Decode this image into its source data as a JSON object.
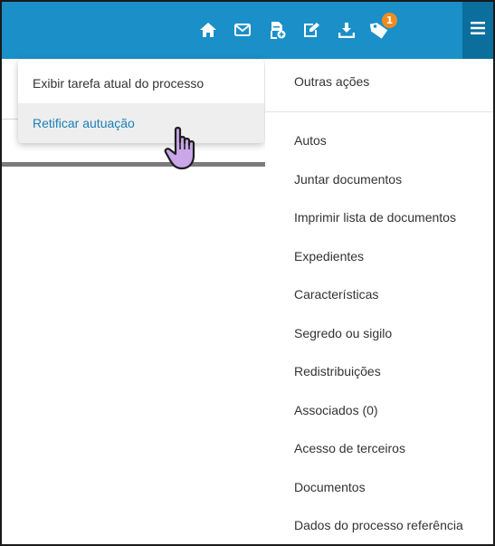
{
  "topbar": {
    "icons": [
      "home-icon",
      "mail-icon",
      "document-plus-icon",
      "edit-icon",
      "download-icon",
      "tag-icon",
      "menu-icon"
    ],
    "notification_count": "1",
    "bg_color": "#1a8fc8"
  },
  "popup": {
    "items": [
      {
        "label": "Exibir tarefa atual do processo"
      },
      {
        "label": "Retificar autuação"
      }
    ]
  },
  "sidebar": {
    "header": "Outras ações",
    "items": [
      {
        "label": "Autos"
      },
      {
        "label": "Juntar documentos"
      },
      {
        "label": "Imprimir lista de documentos"
      },
      {
        "label": "Expedientes"
      },
      {
        "label": "Características"
      },
      {
        "label": "Segredo ou sigilo"
      },
      {
        "label": "Redistribuições"
      },
      {
        "label": "Associados (0)"
      },
      {
        "label": "Acesso de terceiros"
      },
      {
        "label": "Documentos"
      },
      {
        "label": "Dados do processo referência"
      }
    ]
  }
}
